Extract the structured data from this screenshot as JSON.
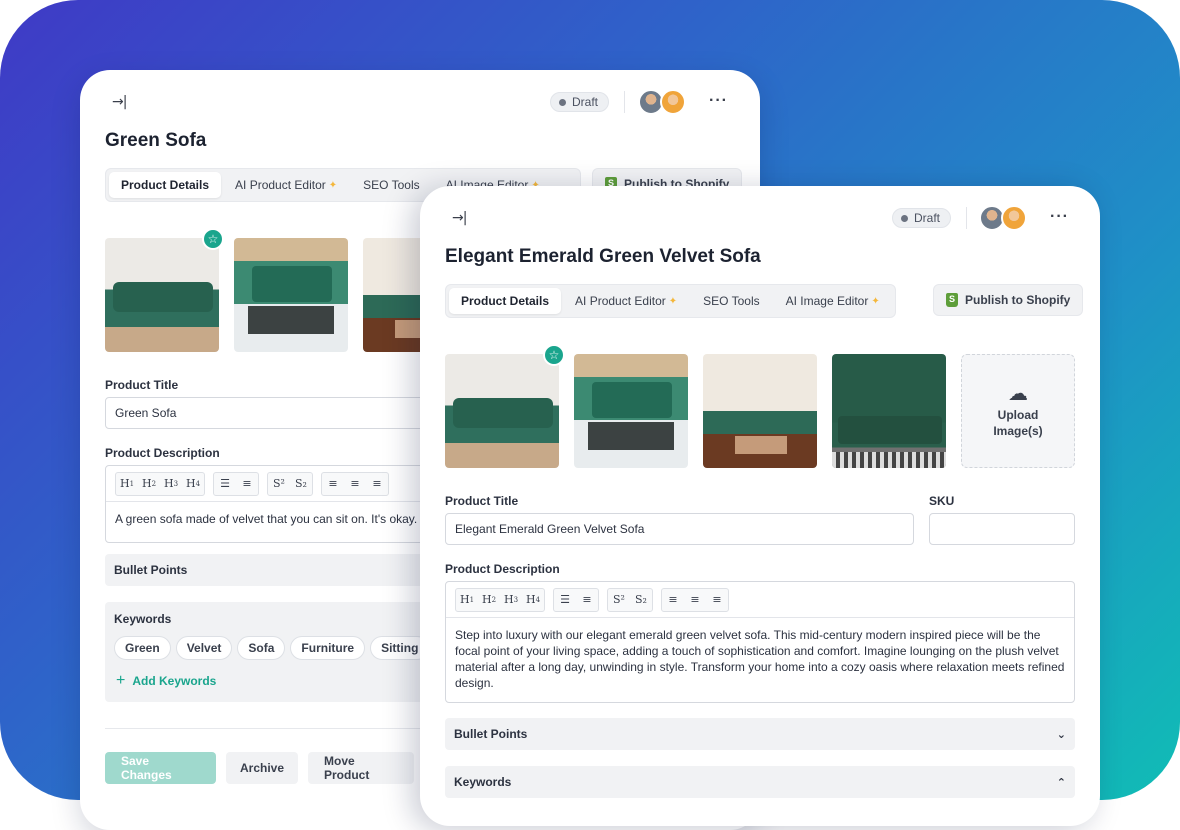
{
  "back_card": {
    "status": "Draft",
    "title": "Green Sofa",
    "tabs": [
      "Product Details",
      "AI Product Editor",
      "SEO Tools",
      "AI Image Editor"
    ],
    "publish_label": "Publish to Shopify",
    "product_title_label": "Product Title",
    "product_title_value": "Green Sofa",
    "description_label": "Product Description",
    "description_text": "A green sofa made of velvet that you can sit on. It's okay.",
    "bullet_points_label": "Bullet Points",
    "keywords_label": "Keywords",
    "keywords": [
      "Green",
      "Velvet",
      "Sofa",
      "Furniture",
      "Sitting"
    ],
    "add_keywords_label": "Add Keywords",
    "save_label": "Save  Changes",
    "archive_label": "Archive",
    "move_label": "Move Product"
  },
  "front_card": {
    "status": "Draft",
    "title": "Elegant Emerald Green Velvet Sofa",
    "tabs": [
      "Product Details",
      "AI Product Editor",
      "SEO Tools",
      "AI Image Editor"
    ],
    "publish_label": "Publish to Shopify",
    "upload_label": "Upload Image(s)",
    "product_title_label": "Product Title",
    "product_title_value": "Elegant Emerald Green Velvet Sofa",
    "sku_label": "SKU",
    "sku_value": "",
    "description_label": "Product Description",
    "description_text": "Step into luxury with our elegant emerald green velvet sofa. This mid-century modern inspired piece will be the focal point of your living space, adding a touch of sophistication and comfort. Imagine lounging on the plush velvet material after a long day, unwinding in style. Transform your home into a cozy oasis where relaxation meets refined design.",
    "bullet_points_label": "Bullet Points",
    "keywords_label": "Keywords"
  },
  "toolbar": {
    "headings": [
      "H1",
      "H2",
      "H3",
      "H4"
    ],
    "script": [
      "S²",
      "S₂"
    ]
  },
  "colors": {
    "accent": "#1aa58d",
    "gradient_start": "#3f3ac6",
    "gradient_end": "#10bdb5"
  }
}
